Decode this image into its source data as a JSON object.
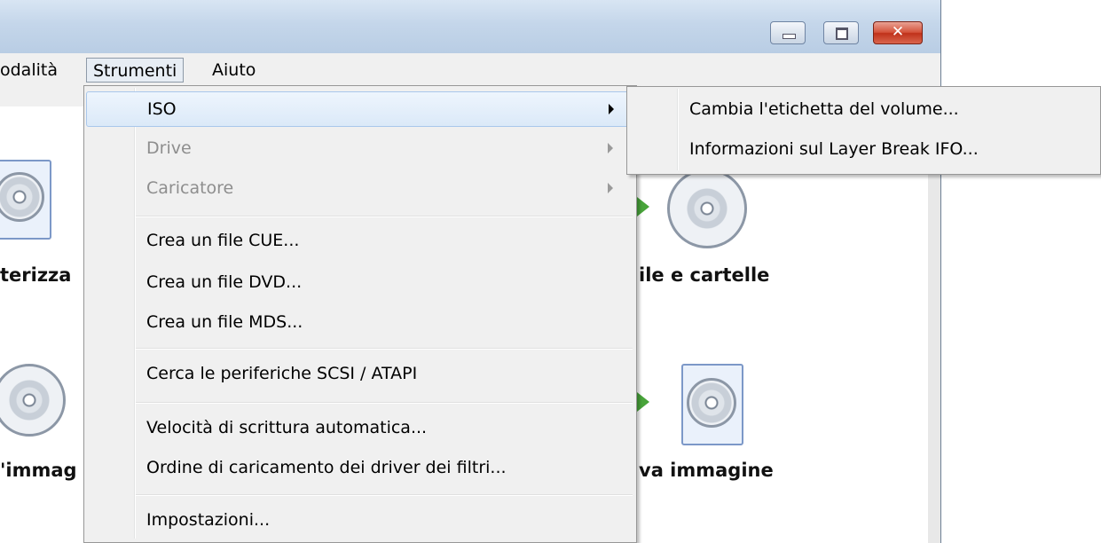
{
  "menubar": {
    "items": [
      "odalità",
      "Strumenti",
      "Aiuto"
    ]
  },
  "window_buttons": {
    "close_glyph": "✕"
  },
  "background_labels": {
    "left_top": "terizza",
    "right_top": "ile e cartelle",
    "left_bottom": "'immag",
    "right_bottom": "va immagine"
  },
  "menu": {
    "items": [
      {
        "label": "ISO",
        "submenu": true,
        "disabled": false,
        "highlighted": true
      },
      {
        "label": "Drive",
        "submenu": true,
        "disabled": true
      },
      {
        "label": "Caricatore",
        "submenu": true,
        "disabled": true
      },
      {
        "label": "Crea un file CUE..."
      },
      {
        "label": "Crea un file DVD..."
      },
      {
        "label": "Crea un file MDS..."
      },
      {
        "label": "Cerca le periferiche SCSI / ATAPI"
      },
      {
        "label": "Velocità di scrittura automatica..."
      },
      {
        "label": "Ordine di caricamento dei driver dei filtri..."
      },
      {
        "label": "Impostazioni..."
      }
    ]
  },
  "submenu": {
    "items": [
      {
        "label": "Cambia l'etichetta del volume..."
      },
      {
        "label": "Informazioni sul Layer Break IFO..."
      }
    ]
  }
}
